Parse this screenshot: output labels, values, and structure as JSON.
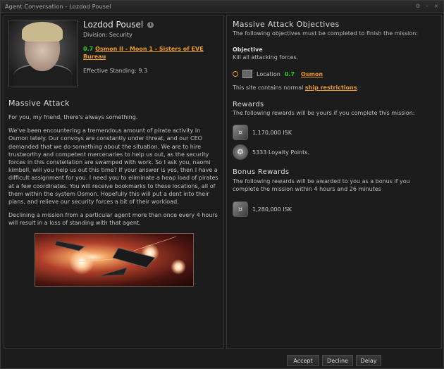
{
  "window": {
    "title": "Agent Conversation - Lozdod Pousel"
  },
  "agent": {
    "name": "Lozdod Pousel",
    "division": "Division: Security",
    "security": "0.7",
    "station": "Osmon II - Moon 1 - Sisters of EVE Bureau",
    "standing": "Effective Standing: 9.3"
  },
  "mission": {
    "title": "Massive Attack",
    "paragraphs": [
      "For you, my friend, there's always something.",
      "We've been encountering a tremendous amount of pirate activity in Osmon lately. Our convoys are constantly under threat, and our CEO demanded that we do something about the situation. We are to hire trustworthy and competent mercenaries to help us out, as the security forces in this constellation are swamped with work. So I ask you, naomi kimbell, will you help us out this time? If your answer is yes, then I have a difficult assignment for you. I need you to eliminate a heap load of pirates at a few coordinates. You will receive bookmarks to these locations, all of them within the system Osmon. Hopefully this will put a dent into their plans, and relieve our security forces a bit of their workload.",
      "Declining a mission from a particular agent more than once every 4 hours will result in a loss of standing with that agent."
    ]
  },
  "objectives": {
    "title": "Massive Attack Objectives",
    "intro": "The following objectives must be completed to finish the mission:",
    "objective_heading": "Objective",
    "objective_text": "Kill all attacking forces.",
    "location_label": "Location",
    "location_security": "0.7",
    "location_name": "Osmon",
    "restrictions_prefix": "This site contains normal",
    "restrictions_link": "ship restrictions",
    "restrictions_suffix": "."
  },
  "rewards": {
    "title": "Rewards",
    "intro": "The following rewards will be yours if you complete this mission:",
    "items": [
      {
        "text": "1,170,000 ISK"
      },
      {
        "text": "5333 Loyalty Points."
      }
    ]
  },
  "bonus": {
    "title": "Bonus Rewards",
    "intro": "The following rewards will be awarded to you as a bonus if you complete the mission within 4 hours and 26 minutes",
    "items": [
      {
        "text": "1,280,000 ISK"
      }
    ]
  },
  "buttons": {
    "accept": "Accept",
    "decline": "Decline",
    "delay": "Delay"
  },
  "colors": {
    "link": "#e89a2a",
    "security_high": "#2bcf2b"
  }
}
